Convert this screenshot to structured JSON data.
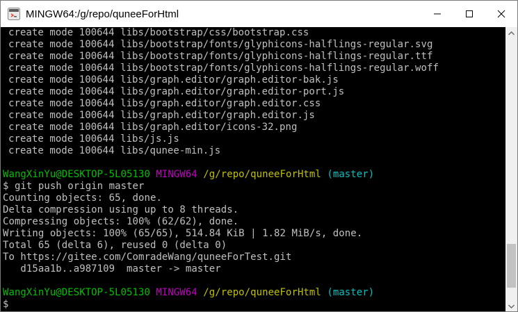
{
  "window": {
    "title": "MINGW64:/g/repo/quneeForHtml"
  },
  "icons": {
    "app": "git-bash-icon",
    "minimize": "minimize-icon",
    "maximize": "maximize-icon",
    "close": "close-icon",
    "scroll_up": "chevron-up-icon",
    "scroll_down": "chevron-down-icon"
  },
  "colors": {
    "prompt_user": "#00c000",
    "prompt_env": "#c000c0",
    "prompt_path": "#c0c000",
    "prompt_branch": "#00c0c0",
    "text": "#c0c0c0"
  },
  "output": {
    "created_files": [
      "create mode 100644 libs/bootstrap/css/bootstrap.css",
      "create mode 100644 libs/bootstrap/fonts/glyphicons-halflings-regular.svg",
      "create mode 100644 libs/bootstrap/fonts/glyphicons-halflings-regular.ttf",
      "create mode 100644 libs/bootstrap/fonts/glyphicons-halflings-regular.woff",
      "create mode 100644 libs/graph.editor/graph.editor-bak.js",
      "create mode 100644 libs/graph.editor/graph.editor-port.js",
      "create mode 100644 libs/graph.editor/graph.editor.css",
      "create mode 100644 libs/graph.editor/graph.editor.js",
      "create mode 100644 libs/graph.editor/icons-32.png",
      "create mode 100644 libs/js.js",
      "create mode 100644 libs/qunee-min.js"
    ],
    "push_output": [
      "Counting objects: 65, done.",
      "Delta compression using up to 8 threads.",
      "Compressing objects: 100% (62/62), done.",
      "Writing objects: 100% (65/65), 514.84 KiB | 1.82 MiB/s, done.",
      "Total 65 (delta 6), reused 0 (delta 0)",
      "To https://gitee.com/ComradeWang/quneeForTest.git",
      "   d15aa1b..a987109  master -> master"
    ]
  },
  "prompt": {
    "user": "WangXinYu@DESKTOP-5L05130",
    "env": "MINGW64",
    "path": "/g/repo/quneeForHtml",
    "branch": "(master)"
  },
  "commands": {
    "push": "$ git push origin master",
    "current": "$"
  }
}
